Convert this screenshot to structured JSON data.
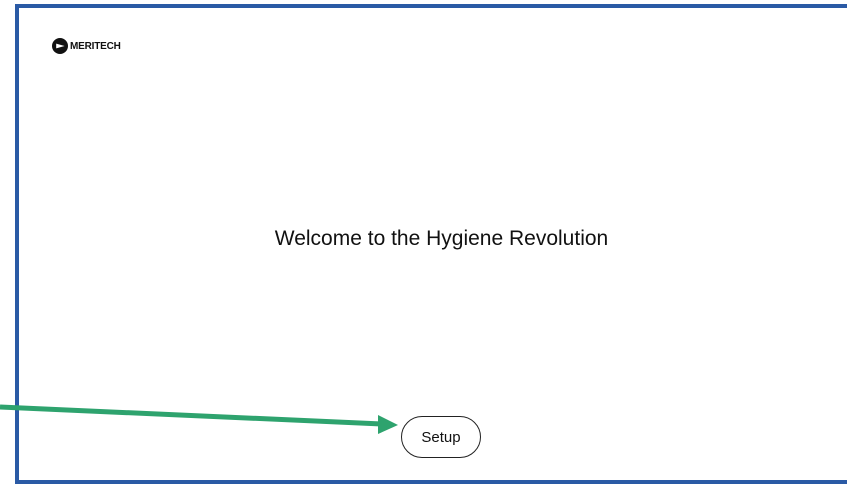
{
  "brand": {
    "name": "MERITECH",
    "logo_icon": "meritech-logo-icon"
  },
  "main": {
    "title": "Welcome to the Hygiene Revolution"
  },
  "actions": {
    "setup_label": "Setup"
  },
  "annotation": {
    "arrow_color": "#2ea36e",
    "arrow_target": "setup-button"
  },
  "colors": {
    "frame_border": "#2a5aa5",
    "background": "#ffffff",
    "text": "#111111"
  }
}
